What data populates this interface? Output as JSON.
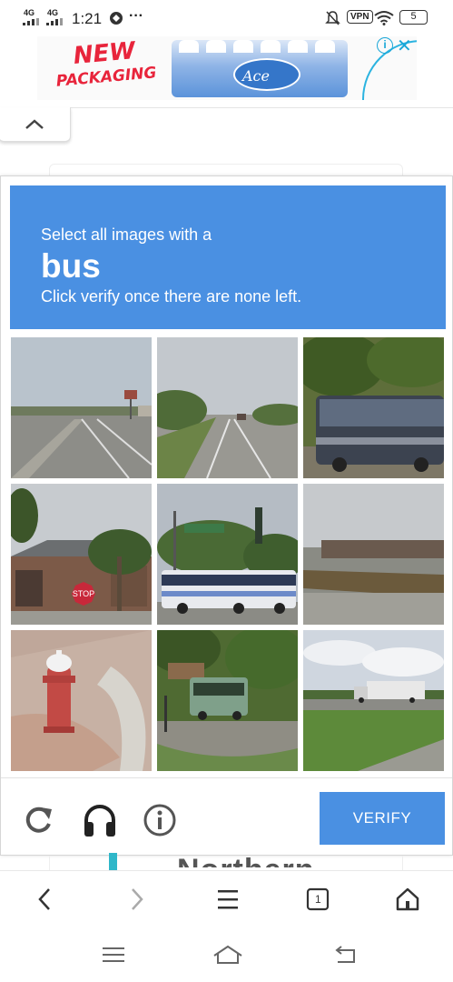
{
  "status_bar": {
    "signal1": "4G",
    "signal2": "4G",
    "time": "1:21",
    "more": "···",
    "vpn": "VPN",
    "battery": "5"
  },
  "ad": {
    "headline_line1": "NEW",
    "headline_line2": "PACKAGING",
    "product_brand": "Ace",
    "info_icon": "i",
    "close_icon": "✕"
  },
  "captcha": {
    "prompt_prefix": "Select all images with a",
    "target_word": "bus",
    "instruction": "Click verify once there are none left.",
    "tiles": [
      {
        "scene": "road-with-sign"
      },
      {
        "scene": "empty-road"
      },
      {
        "scene": "bus-under-trees"
      },
      {
        "scene": "building-stop-sign"
      },
      {
        "scene": "articulated-bus"
      },
      {
        "scene": "field-building"
      },
      {
        "scene": "fire-hydrant"
      },
      {
        "scene": "shuttle-bus"
      },
      {
        "scene": "truck-on-highway"
      }
    ],
    "sign_text": "STOP",
    "verify_label": "VERIFY",
    "header_color": "#4a90e2"
  },
  "underlying_page": {
    "partial_heading": "Northern"
  },
  "browser_nav": {
    "tab_count": "1"
  },
  "icons": {
    "collapse": "chevron-up-icon",
    "reload": "reload-icon",
    "audio": "headphones-icon",
    "info": "info-icon",
    "back": "back-arrow-icon",
    "forward": "forward-arrow-icon",
    "menu": "menu-icon",
    "tabs": "tabs-icon",
    "home": "home-icon"
  }
}
